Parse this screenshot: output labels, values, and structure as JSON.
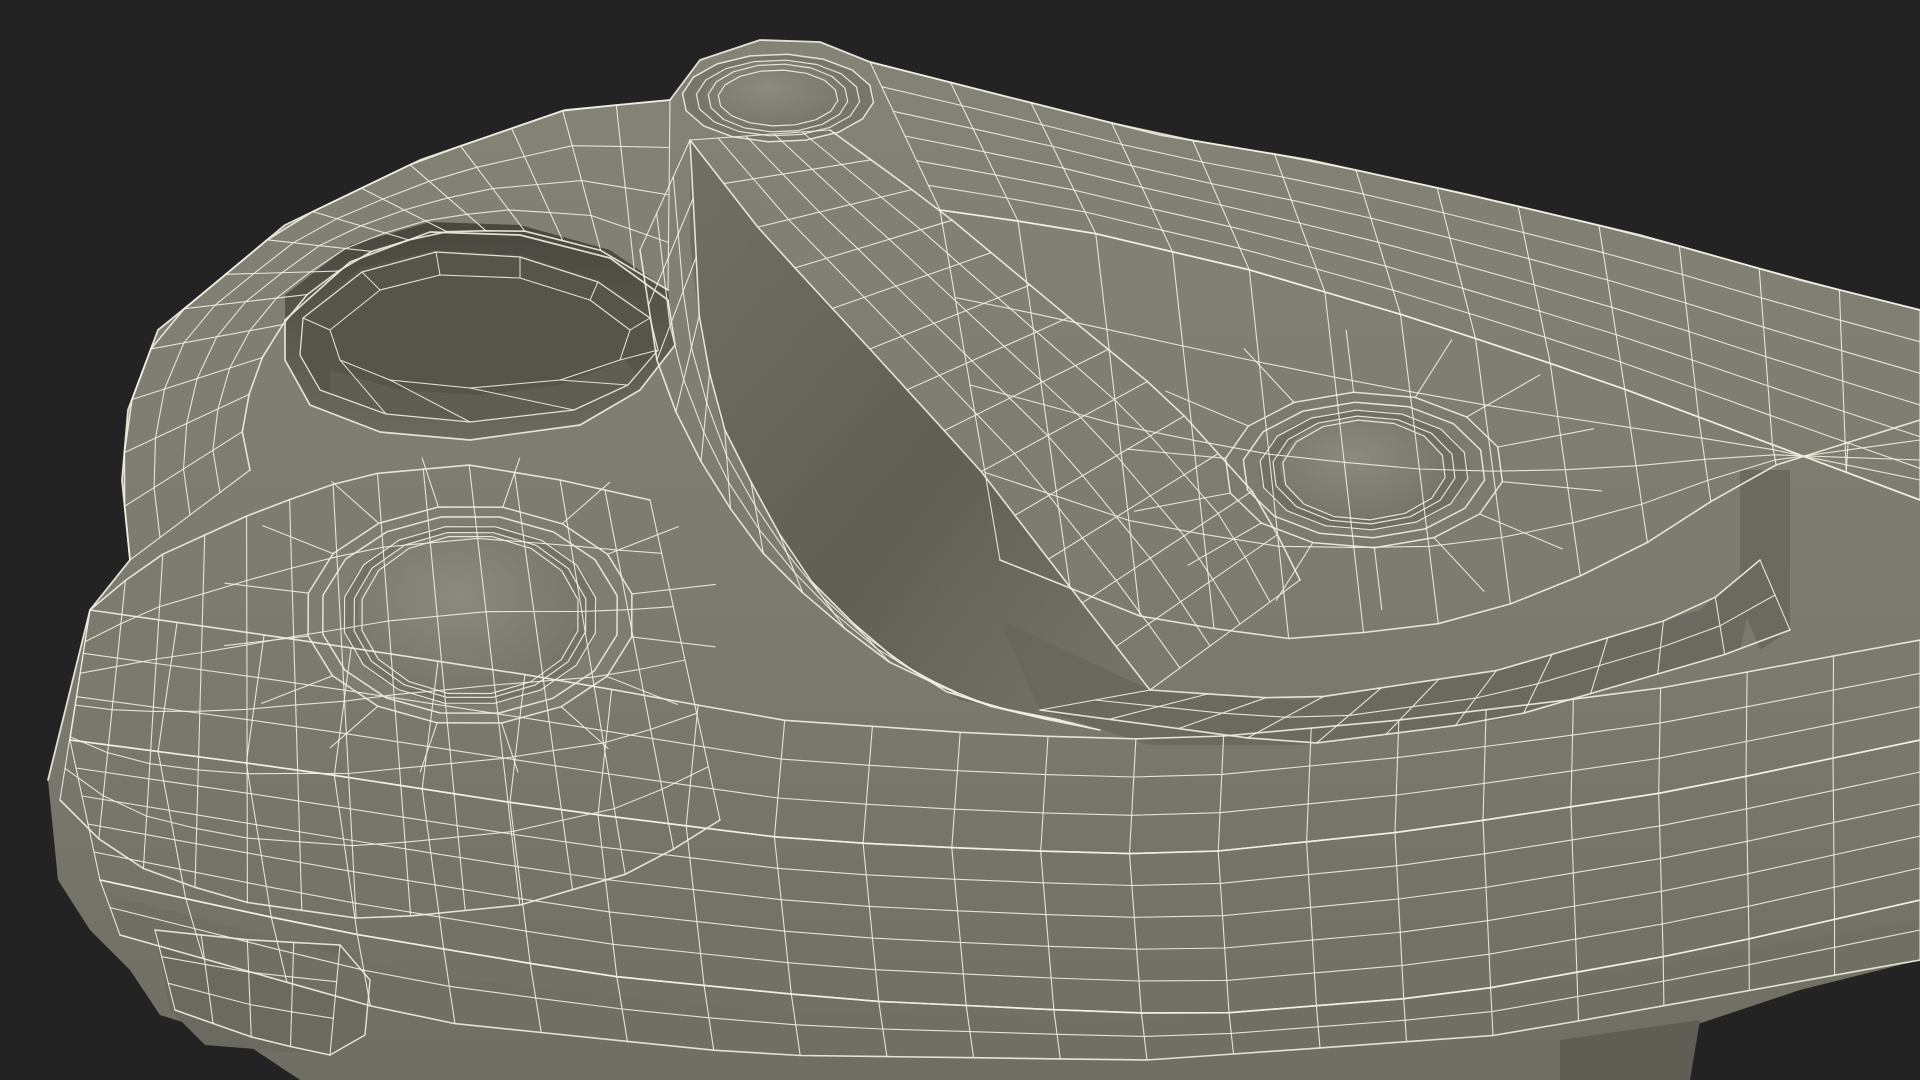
{
  "scene": {
    "background_color": "#232323",
    "surface_color": "#7a7a6e",
    "surface_shadow_color": "#56564d",
    "surface_dark_color": "#3f3f38",
    "wireframe_color": "#f1f0e2",
    "subject": "wireframe-3d-model"
  }
}
